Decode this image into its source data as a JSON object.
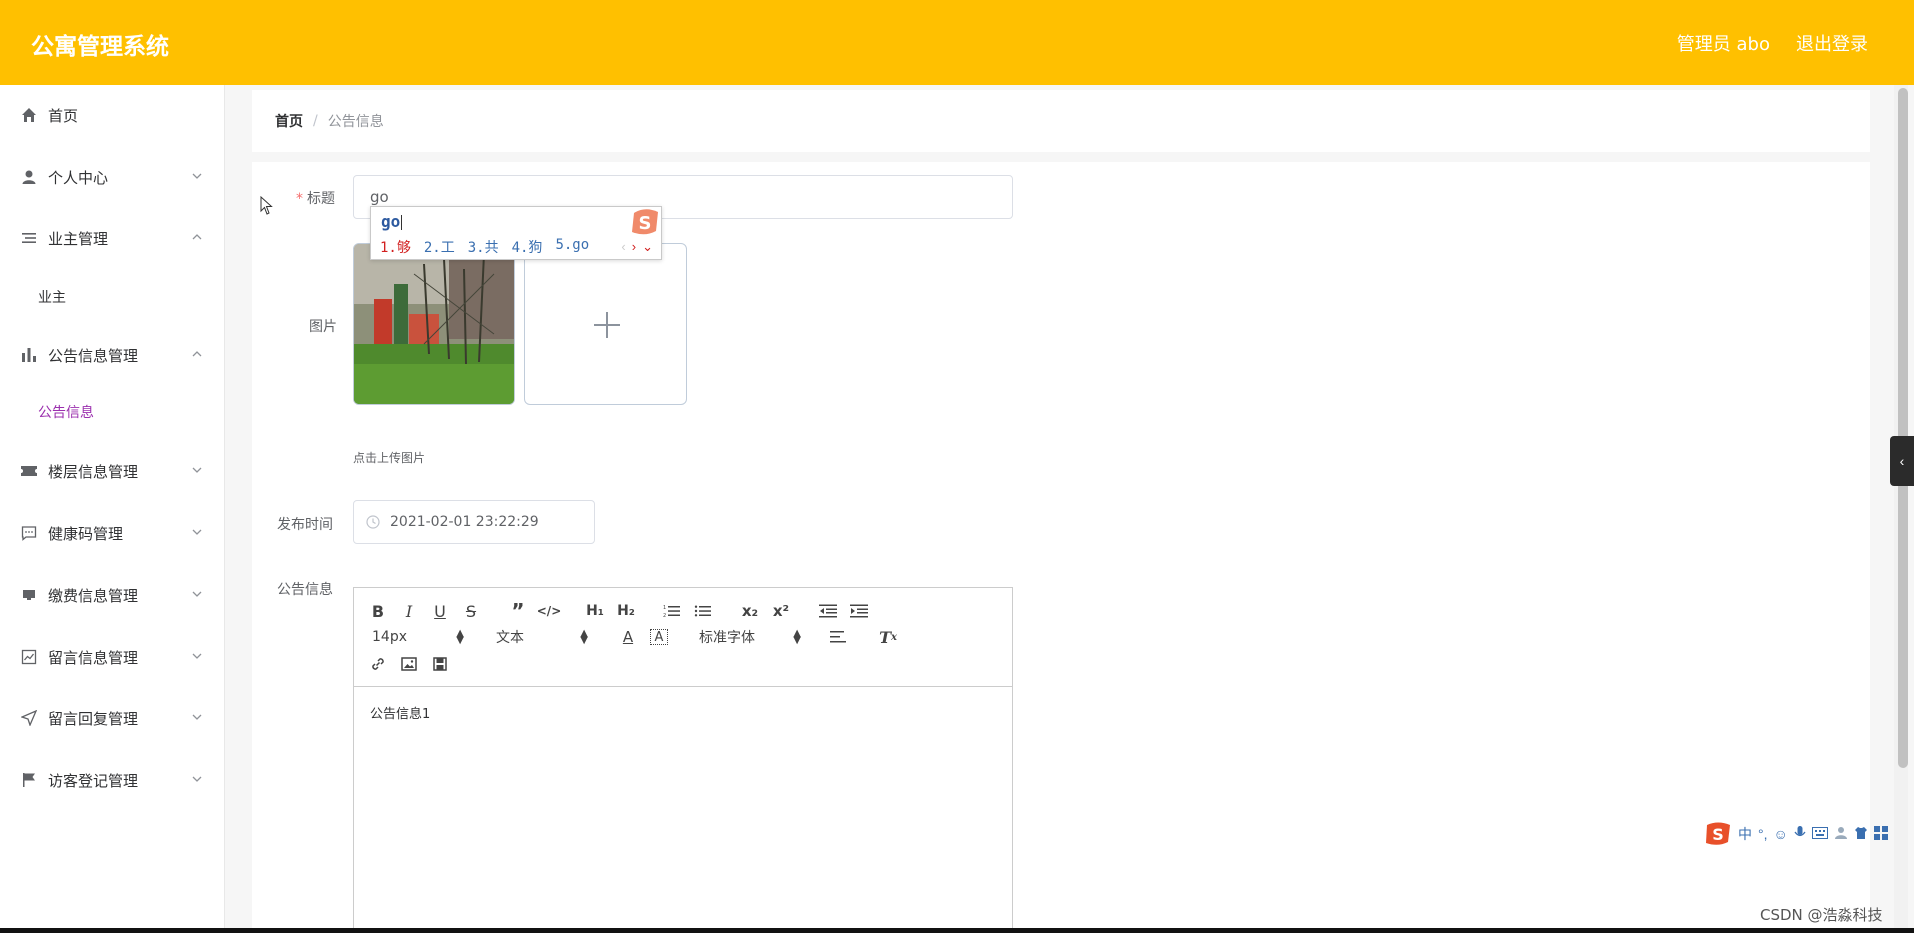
{
  "header": {
    "brand": "公寓管理系统",
    "admin": "管理员 abo",
    "logout": "退出登录"
  },
  "sidebar": {
    "items": [
      {
        "label": "首页",
        "icon": "home-icon"
      },
      {
        "label": "个人中心",
        "icon": "user-icon",
        "state": "collapsed"
      },
      {
        "label": "业主管理",
        "icon": "list-icon",
        "state": "expanded"
      },
      {
        "label": "公告信息管理",
        "icon": "bar-chart-icon",
        "state": "expanded"
      },
      {
        "label": "楼层信息管理",
        "icon": "ticket-icon",
        "state": "collapsed"
      },
      {
        "label": "健康码管理",
        "icon": "chat-icon",
        "state": "collapsed"
      },
      {
        "label": "缴费信息管理",
        "icon": "box-icon",
        "state": "collapsed"
      },
      {
        "label": "留言信息管理",
        "icon": "line-chart-icon",
        "state": "collapsed"
      },
      {
        "label": "留言回复管理",
        "icon": "send-icon",
        "state": "collapsed"
      },
      {
        "label": "访客登记管理",
        "icon": "flag-icon",
        "state": "collapsed"
      }
    ],
    "sub_items": {
      "owner": "业主",
      "notice": "公告信息"
    },
    "active_color": "#9b2fae"
  },
  "breadcrumb": {
    "home": "首页",
    "separator": "/",
    "current": "公告信息"
  },
  "form": {
    "title_label": "标题",
    "title_value": "go",
    "image_label": "图片",
    "upload_tip": "点击上传图片",
    "time_label": "发布时间",
    "time_value": "2021-02-01 23:22:29",
    "content_label": "公告信息",
    "content_value": "公告信息1"
  },
  "ime_popup": {
    "composition": "go",
    "candidates": [
      "1.够",
      "2.工",
      "3.共",
      "4.狗",
      "5.go"
    ]
  },
  "editor_toolbar": {
    "font_size": "14px",
    "header_select": "文本",
    "font_family": "标准字体"
  },
  "ime_bar": {
    "mode": "中",
    "punct": "°,"
  },
  "watermark": "CSDN @浩淼科技",
  "colors": {
    "header_bg": "#ffc000",
    "accent": "#9b2fae",
    "required": "#f56c6c"
  }
}
